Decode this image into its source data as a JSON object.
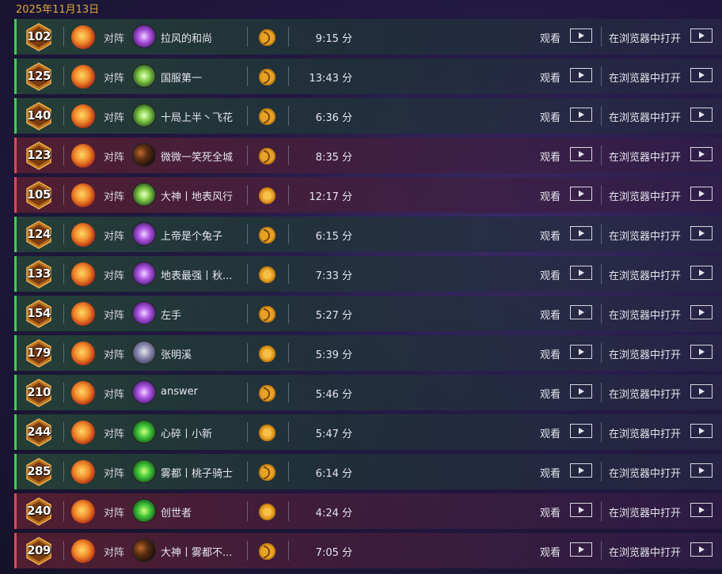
{
  "date": "2025年11月13日",
  "mode_label": "对阵",
  "watch_label": "观看",
  "browser_label": "在浏览器中打开",
  "colors": {
    "win": "#3bd14c",
    "loss": "#e5474f",
    "accent": "#e0a83a"
  },
  "rows": [
    {
      "rank": "102",
      "result": "win",
      "hero": "hero-purple",
      "opponent": "拉风的和尚",
      "coin": "swirl",
      "duration": "9:15 分"
    },
    {
      "rank": "125",
      "result": "win",
      "hero": "hero-green",
      "opponent": "国服第一",
      "coin": "swirl",
      "duration": "13:43 分"
    },
    {
      "rank": "140",
      "result": "win",
      "hero": "hero-green",
      "opponent": "十局上半丶飞花",
      "coin": "swirl",
      "duration": "6:36 分"
    },
    {
      "rank": "123",
      "result": "loss",
      "hero": "hero-dark",
      "opponent": "微微一笑死全城",
      "coin": "swirl",
      "duration": "8:35 分"
    },
    {
      "rank": "105",
      "result": "loss",
      "hero": "hero-green",
      "opponent": "大神丨地表风行",
      "coin": "full",
      "duration": "12:17 分"
    },
    {
      "rank": "124",
      "result": "win",
      "hero": "hero-purple",
      "opponent": "上帝是个兔子",
      "coin": "swirl",
      "duration": "6:15 分"
    },
    {
      "rank": "133",
      "result": "win",
      "hero": "hero-purple",
      "opponent": "地表最强丨秋...",
      "coin": "full",
      "duration": "7:33 分"
    },
    {
      "rank": "154",
      "result": "win",
      "hero": "hero-purple",
      "opponent": "左手",
      "coin": "swirl",
      "duration": "5:27 分"
    },
    {
      "rank": "179",
      "result": "win",
      "hero": "hero-grey",
      "opponent": "张明溪",
      "coin": "full",
      "duration": "5:39 分"
    },
    {
      "rank": "210",
      "result": "win",
      "hero": "hero-purple",
      "opponent": "answer",
      "coin": "swirl",
      "duration": "5:46 分"
    },
    {
      "rank": "244",
      "result": "win",
      "hero": "hero-lime",
      "opponent": "心碎丨小新",
      "coin": "full",
      "duration": "5:47 分"
    },
    {
      "rank": "285",
      "result": "win",
      "hero": "hero-lime",
      "opponent": "雾都丨桃子骑士",
      "coin": "swirl",
      "duration": "6:14 分"
    },
    {
      "rank": "240",
      "result": "loss",
      "hero": "hero-lime",
      "opponent": "创世者",
      "coin": "full",
      "duration": "4:24 分"
    },
    {
      "rank": "209",
      "result": "loss",
      "hero": "hero-dark",
      "opponent": "大神丨雾都不...",
      "coin": "swirl",
      "duration": "7:05 分"
    }
  ]
}
